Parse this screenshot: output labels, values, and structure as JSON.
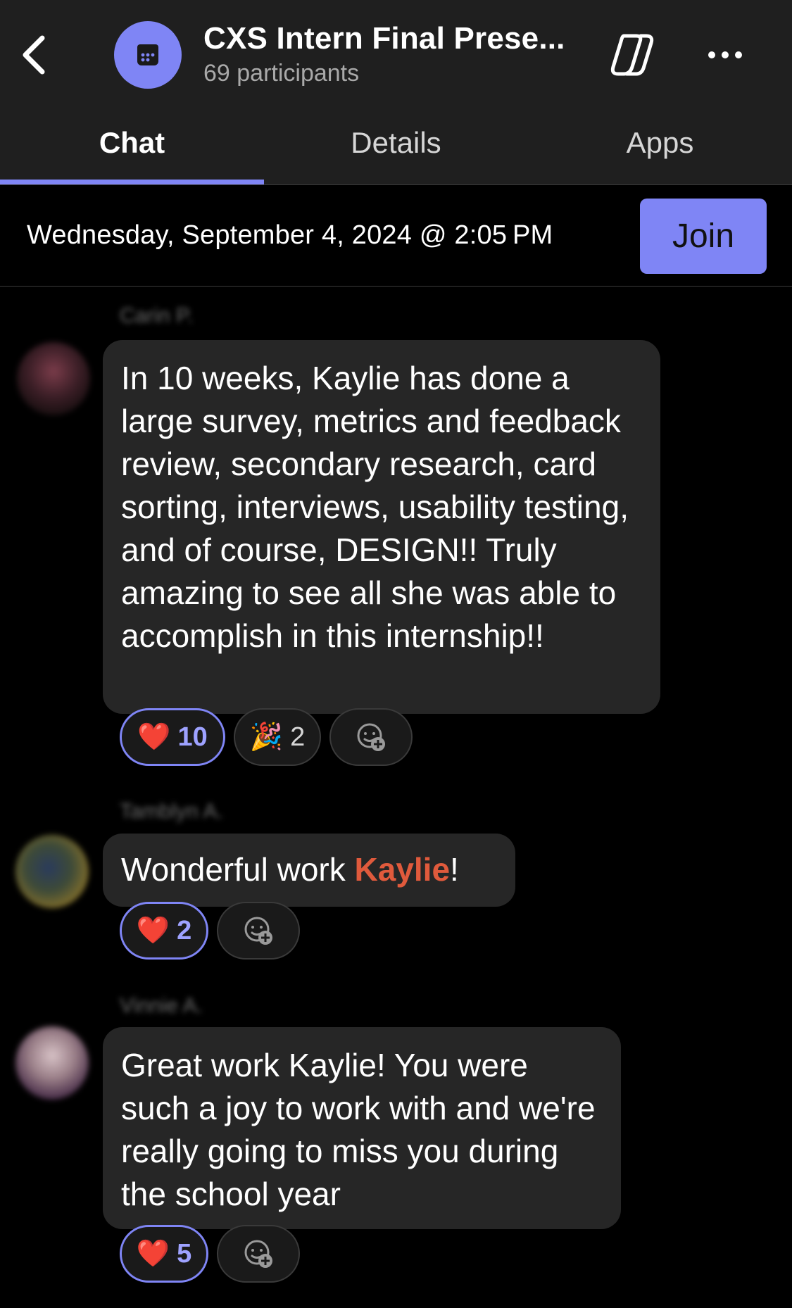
{
  "header": {
    "title": "CXS Intern Final Prese...",
    "subtitle": "69 participants",
    "back_icon": "chevron-left-icon",
    "meeting_icon": "calendar-icon",
    "copilot_icon": "copilot-icon",
    "more_icon": "ellipsis-icon"
  },
  "tabs": [
    {
      "label": "Chat",
      "active": true
    },
    {
      "label": "Details",
      "active": false
    },
    {
      "label": "Apps",
      "active": false
    }
  ],
  "meeting": {
    "date": "Wednesday, September 4, 2024 @ 2:05 PM",
    "join_label": "Join"
  },
  "colors": {
    "accent": "#7f85f5",
    "mention": "#e05a3c",
    "bubble": "#262626",
    "header_bg": "#1f1f1f"
  },
  "messages": [
    {
      "sender": "Carin P.",
      "text": "In 10 weeks, Kaylie has done a large survey, metrics and feedback review, secondary research, card sorting, interviews, usability testing, and of course, DESIGN!! Truly amazing to see all she was able to accomplish in this internship!!",
      "reactions": [
        {
          "emoji": "❤️",
          "count": "10",
          "mine": true
        },
        {
          "emoji": "🎉",
          "count": "2",
          "mine": false
        }
      ]
    },
    {
      "sender": "Tamblyn A.",
      "text_before": "Wonderful work ",
      "mention": "Kaylie",
      "text_after": "!",
      "reactions": [
        {
          "emoji": "❤️",
          "count": "2",
          "mine": true
        }
      ]
    },
    {
      "sender": "Vinnie A.",
      "text": "Great work Kaylie! You were such a joy to work with and we're really going to miss you during the school year",
      "reactions": [
        {
          "emoji": "❤️",
          "count": "5",
          "mine": true
        }
      ]
    }
  ]
}
